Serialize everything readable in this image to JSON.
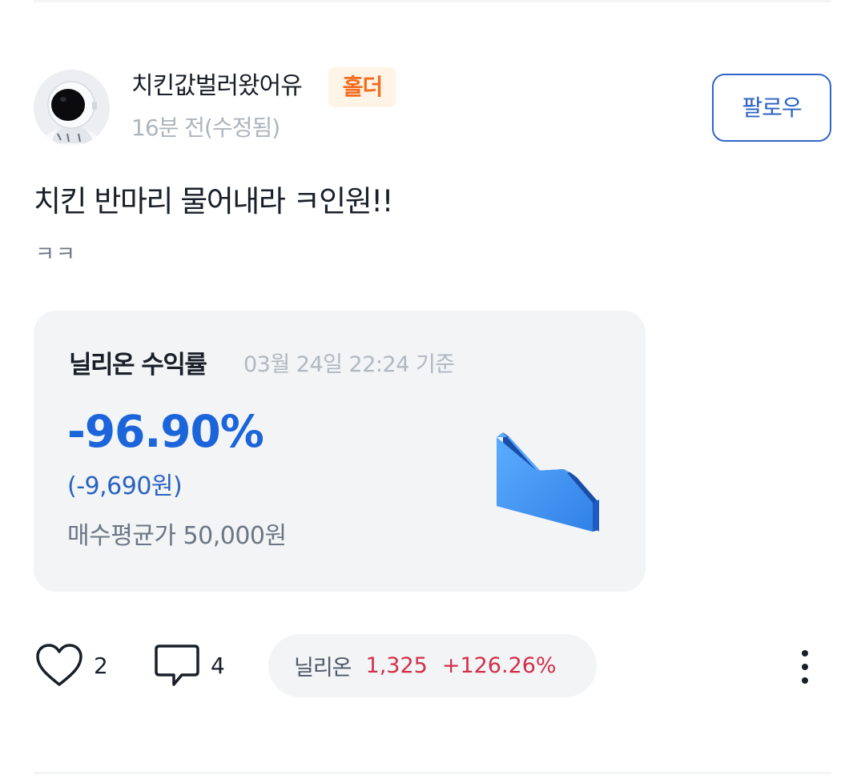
{
  "post": {
    "author": {
      "username": "치킨값벌러왔어유",
      "badge": "홀더",
      "timestamp": "16분 전(수정됨)"
    },
    "follow_label": "팔로우",
    "title": "치킨 반마리 물어내라 ㅋ인원!!",
    "body": "ㅋㅋ"
  },
  "return_card": {
    "title": "닐리온 수익률",
    "as_of": "03월 24일 22:24 기준",
    "rate": "-96.90%",
    "amount": "(-9,690원)",
    "avg_price": "매수평균가 50,000원",
    "graphic_icon": "down-trend-icon"
  },
  "actions": {
    "like_count": "2",
    "comment_count": "4",
    "stock": {
      "name": "닐리온",
      "price": "1,325",
      "change": "+126.26%"
    }
  },
  "colors": {
    "accent_blue": "#1b64da",
    "follow_blue": "#2d62c3",
    "rise_red": "#d22f4b",
    "badge_orange": "#f36c20",
    "badge_bg": "#fff4e6",
    "card_bg": "#f2f4f6"
  }
}
